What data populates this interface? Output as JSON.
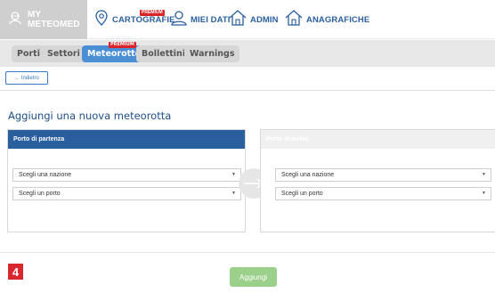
{
  "topnav": {
    "brand": "MY METEOMED",
    "items": [
      {
        "label": "CARTOGRAFIE",
        "badge": "PREMIUM"
      },
      {
        "label": "MIEI DATI"
      },
      {
        "label": "ADMIN"
      },
      {
        "label": "ANAGRAFICHE"
      }
    ]
  },
  "subnav": {
    "tabs": [
      {
        "label": "Porti"
      },
      {
        "label": "Settori"
      },
      {
        "label": "Meteorotte",
        "badge": "PREMIUM",
        "active": true
      },
      {
        "label": "Bollettini"
      },
      {
        "label": "Warnings"
      }
    ]
  },
  "back": {
    "label": "← Indietro"
  },
  "page": {
    "title": "Aggiungi una nuova meteorotta"
  },
  "departure": {
    "title": "Porto di partenza",
    "nation_select": "Scegli una nazione",
    "port_select": "Scegli un porto"
  },
  "arrival": {
    "title": "Porto di arrivo",
    "nation_select": "Scegli una nazione",
    "port_select": "Scegli un porto"
  },
  "step_number": "4",
  "add_button": "Aggiungi",
  "colors": {
    "primary": "#2a5f9e",
    "tab_active": "#4a8ed6",
    "premium": "#d9242a",
    "add_button": "#9bd08a",
    "step_badge": "#d8272d"
  },
  "icons": {
    "brand": "user-helmet-icon",
    "cartografie": "map-pin-icon",
    "miei_dati": "user-icon",
    "admin": "home-icon",
    "anagrafiche": "home-icon",
    "arrow": "arrow-right-icon",
    "caret": "caret-down-icon"
  }
}
